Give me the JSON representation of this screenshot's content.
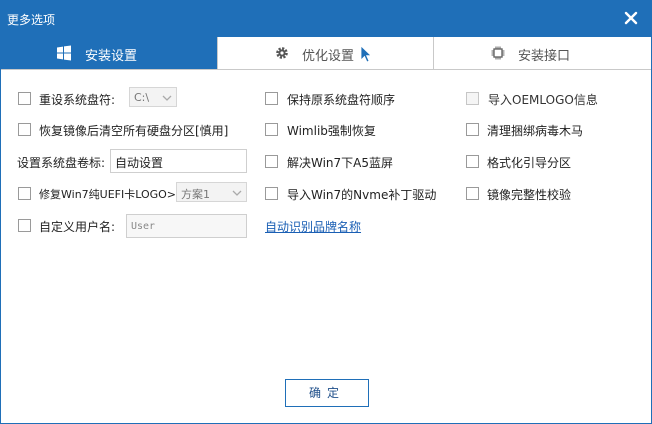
{
  "window": {
    "title": "更多选项",
    "accent": "#1f6fb8"
  },
  "tabs": [
    {
      "label": "安装设置",
      "icon": "windows-logo-icon",
      "active": true
    },
    {
      "label": "优化设置",
      "icon": "gear-icon",
      "active": false
    },
    {
      "label": "安装接口",
      "icon": "chip-icon",
      "active": false
    }
  ],
  "col1": {
    "reset_drive": {
      "label": "重设系统盘符:",
      "select_value": "C:\\"
    },
    "clear_partitions": {
      "label": "恢复镜像后清空所有硬盘分区[慎用]"
    },
    "volume_label": {
      "label": "设置系统盘卷标:",
      "value": "自动设置"
    },
    "fix_logo": {
      "label": "修复Win7纯UEFI卡LOGO>>",
      "select_value": "方案1"
    },
    "custom_user": {
      "label": "自定义用户名:",
      "placeholder": "User"
    }
  },
  "col2": {
    "keep_order": {
      "label": "保持原系统盘符顺序"
    },
    "wimlib": {
      "label": "Wimlib强制恢复"
    },
    "fix_a5": {
      "label": "解决Win7下A5蓝屏"
    },
    "nvme": {
      "label": "导入Win7的Nvme补丁驱动"
    },
    "brand_link": "自动识别品牌名称"
  },
  "col3": {
    "oem_logo": {
      "label": "导入OEMLOGO信息"
    },
    "clean_virus": {
      "label": "清理捆绑病毒木马"
    },
    "format_boot": {
      "label": "格式化引导分区"
    },
    "verify_image": {
      "label": "镜像完整性校验"
    }
  },
  "footer": {
    "ok_label": "确定"
  }
}
